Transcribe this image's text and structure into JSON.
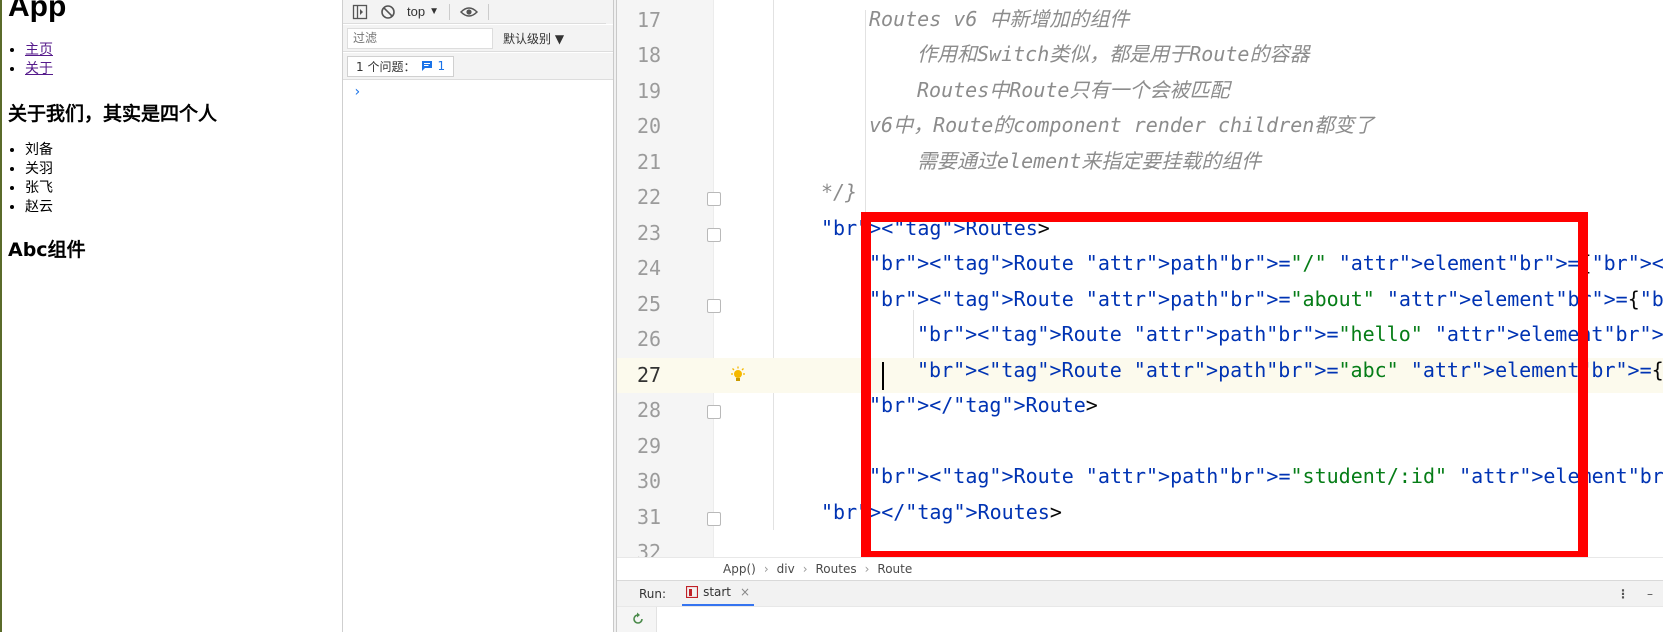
{
  "browser_page": {
    "title": "App",
    "nav": [
      "主页",
      "关于"
    ],
    "about_heading": "关于我们，其实是四个人",
    "people": [
      "刘备",
      "关羽",
      "张飞",
      "赵云"
    ],
    "abc_heading": "Abc组件"
  },
  "devtools": {
    "context": "top",
    "filter_placeholder": "过滤",
    "levels": "默认级别 ▼",
    "issues_label": "1 个问题：",
    "issues_count": "1",
    "prompt": "›"
  },
  "editor": {
    "lines": [
      {
        "n": "17",
        "text": "Routes v6 中新增加的组件"
      },
      {
        "n": "18",
        "text": "作用和Switch类似，都是用于Route的容器"
      },
      {
        "n": "19",
        "text": "Routes中Route只有一个会被匹配"
      },
      {
        "n": "20",
        "text": "v6中，Route的component render children都变了"
      },
      {
        "n": "21",
        "text": "需要通过element来指定要挂载的组件"
      },
      {
        "n": "22",
        "text": "*/}"
      },
      {
        "n": "23",
        "text": "<Routes>"
      },
      {
        "n": "24",
        "text": "<Route path=\"/\" element={<Home/>}></Route>"
      },
      {
        "n": "25",
        "text": "<Route path=\"about\" element={<About/>}>"
      },
      {
        "n": "26",
        "text": "<Route path=\"hello\" element={<Hello/>}></Route>"
      },
      {
        "n": "27",
        "text": "<Route path=\"abc\" element={<Abc/>}></Route>"
      },
      {
        "n": "28",
        "text": "</Route>"
      },
      {
        "n": "29",
        "text": ""
      },
      {
        "n": "30",
        "text": "<Route path=\"student/:id\" element={<Student/>}/>"
      },
      {
        "n": "31",
        "text": "</Routes>"
      },
      {
        "n": "32",
        "text": ""
      }
    ]
  },
  "breadcrumb": [
    "App()",
    "div",
    "Routes",
    "Route"
  ],
  "run": {
    "label": "Run:",
    "tab": "start",
    "close": "×",
    "menu": "⋮",
    "minimize": "–"
  },
  "colors": {
    "highlight_box": "#ff0000",
    "tag": "#0033b3",
    "attr": "#174ad4",
    "string": "#067d17",
    "comment": "#8c8c8c"
  }
}
